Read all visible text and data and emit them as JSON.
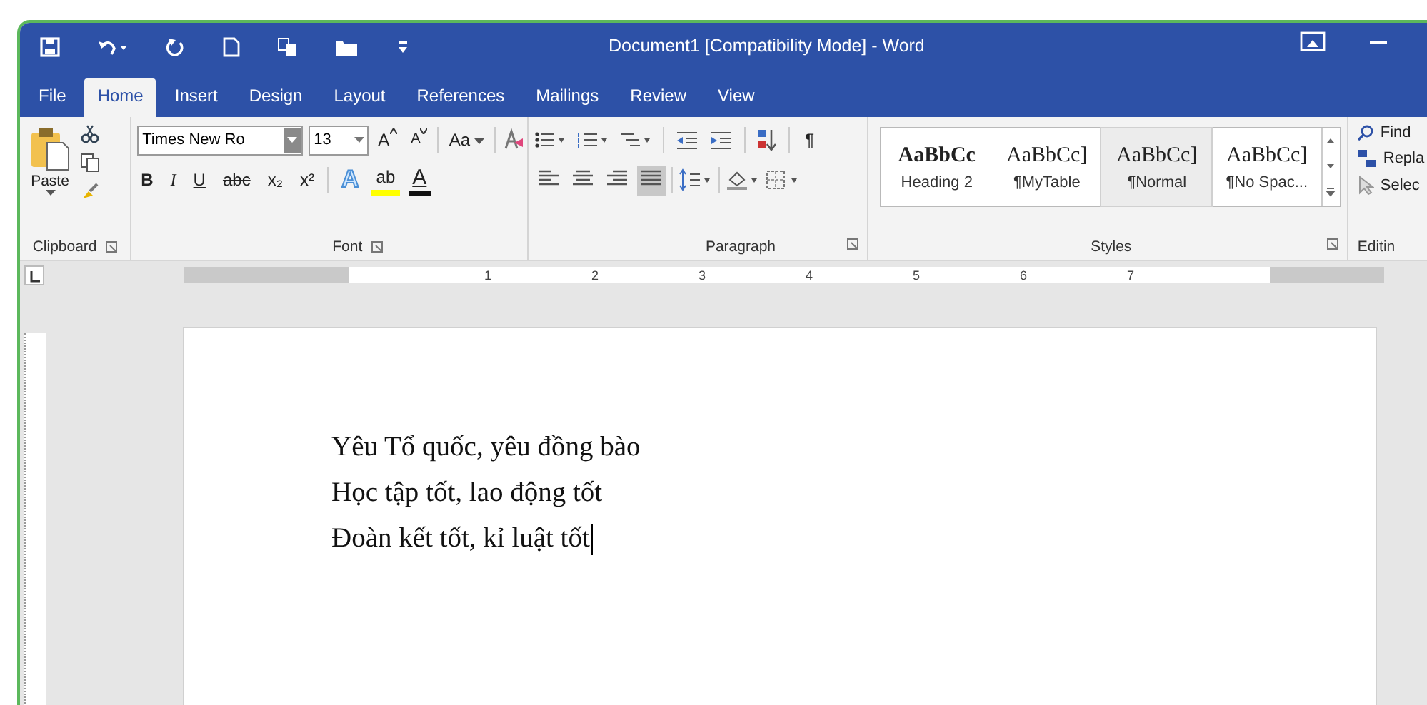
{
  "window": {
    "title": "Document1 [Compatibility Mode] - Word"
  },
  "tabs": [
    {
      "label": "File",
      "selected": false
    },
    {
      "label": "Home",
      "selected": true
    },
    {
      "label": "Insert",
      "selected": false
    },
    {
      "label": "Design",
      "selected": false
    },
    {
      "label": "Layout",
      "selected": false
    },
    {
      "label": "References",
      "selected": false
    },
    {
      "label": "Mailings",
      "selected": false
    },
    {
      "label": "Review",
      "selected": false
    },
    {
      "label": "View",
      "selected": false
    }
  ],
  "clipboard": {
    "paste": "Paste",
    "label": "Clipboard"
  },
  "font": {
    "name": "Times New Ro",
    "size": "13",
    "grow": "A",
    "shrink": "A",
    "change_case": "Aa",
    "format_buttons": [
      {
        "kind": "bold",
        "label": "B"
      },
      {
        "kind": "italic",
        "label": "I"
      },
      {
        "kind": "underline",
        "label": "U"
      },
      {
        "kind": "strike",
        "label": "abc"
      },
      {
        "kind": "plain",
        "label": "x₂"
      },
      {
        "kind": "plain",
        "label": "x²"
      }
    ],
    "effects": "A",
    "highlight": "ab",
    "font_color": "A",
    "label": "Font"
  },
  "paragraph": {
    "alignments": [
      {
        "selected": false
      },
      {
        "selected": false
      },
      {
        "selected": false
      },
      {
        "selected": true
      }
    ],
    "pilcrow": "¶",
    "label": "Paragraph"
  },
  "styles": {
    "items": [
      {
        "preview": "AaBbCc",
        "name": "Heading 2",
        "selected": false
      },
      {
        "preview": "AaBbCc]",
        "name": "¶MyTable",
        "selected": false
      },
      {
        "preview": "AaBbCc]",
        "name": "¶Normal",
        "selected": true
      },
      {
        "preview": "AaBbCc]",
        "name": "¶No Spac...",
        "selected": false
      }
    ],
    "label": "Styles"
  },
  "editing": {
    "find": "Find",
    "replace": "Repla",
    "select": "Selec",
    "label": "Editin"
  },
  "ruler": {
    "numbers": [
      "1",
      "2",
      "3",
      "4",
      "5",
      "6",
      "7"
    ]
  },
  "document": {
    "lines": [
      "Yêu Tổ quốc, yêu đồng bào",
      "Học tập tốt, lao động tốt",
      "Đoàn kết tốt, kỉ luật tốt"
    ]
  }
}
